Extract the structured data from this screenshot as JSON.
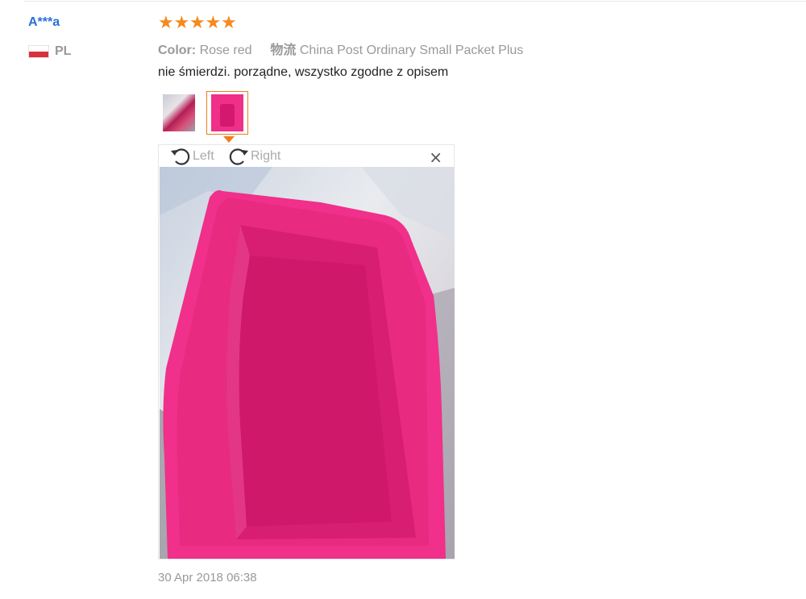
{
  "review": {
    "user_name": "A***a",
    "country_code": "PL",
    "rating": 5,
    "stars": [
      "★",
      "★",
      "★",
      "★",
      "★"
    ],
    "color_key": "Color:",
    "color_value": "Rose red",
    "shipping_key": "物流",
    "shipping_value": "China Post Ordinary Small Packet Plus",
    "text": "nie śmierdzi. porządne, wszystko zgodne z opisem",
    "date": "30 Apr 2018 06:38"
  },
  "viewer": {
    "rotate_left_label": "Left",
    "rotate_right_label": "Right",
    "close_label": "×"
  },
  "colors": {
    "accent": "#f07c1c",
    "star": "#f58a1f",
    "username": "#2a6fd6",
    "product_pink": "#ef2f88"
  },
  "icons": [
    "rotate-left-icon",
    "rotate-right-icon",
    "close-icon",
    "star-icon",
    "poland-flag-icon"
  ]
}
